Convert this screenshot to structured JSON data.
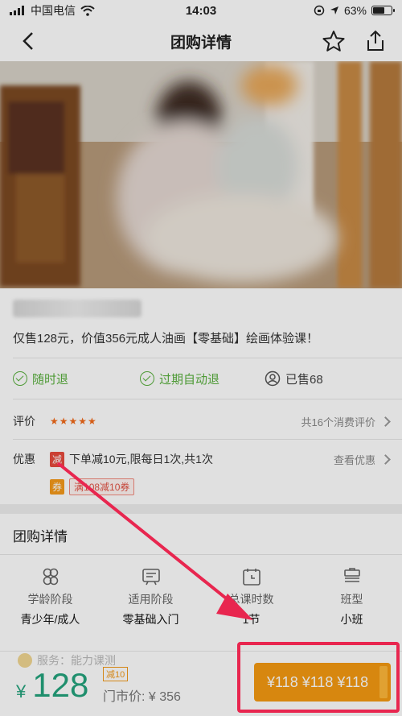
{
  "status": {
    "carrier": "中国电信",
    "time": "14:03",
    "battery": "63%",
    "battery_level": 0.63
  },
  "nav": {
    "title": "团购详情"
  },
  "deal": {
    "description": "仅售128元，价值356元成人油画【零基础】绘画体验课！",
    "features": [
      "随时退",
      "过期自动退",
      "已售68"
    ]
  },
  "rating": {
    "label": "评价",
    "stars": "★★★★★",
    "right": "共16个消费评价"
  },
  "promo": {
    "label": "优惠",
    "tag_jian": "减",
    "jian_text": "下单减10元,限每日1次,共1次",
    "right": "查看优惠",
    "tag_quan": "券",
    "coupon": "满108减10券"
  },
  "section": {
    "title": "团购详情"
  },
  "specs": [
    {
      "icon": "age-icon",
      "label": "学龄阶段",
      "value": "青少年/成人"
    },
    {
      "icon": "stage-icon",
      "label": "适用阶段",
      "value": "零基础入门"
    },
    {
      "icon": "time-icon",
      "label": "总课时数",
      "value": "1节"
    },
    {
      "icon": "class-icon",
      "label": "班型",
      "value": "小班"
    }
  ],
  "bottom": {
    "service": "服务：能力课测",
    "currency": "¥",
    "price": "128",
    "tag": "减10",
    "market": "门市价: ¥ 356",
    "buy_label": "¥118 ¥118 ¥118"
  },
  "colors": {
    "green": "#24a37d",
    "orange": "#f59a12",
    "annotation": "#e8264f"
  }
}
